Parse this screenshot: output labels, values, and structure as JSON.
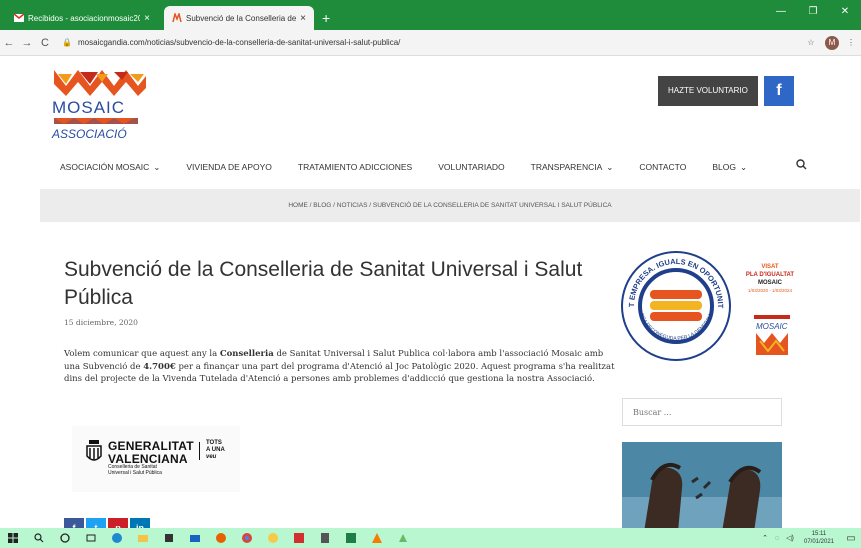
{
  "browser": {
    "tabs": [
      {
        "title": "Recibidos - asociacionmosaic20...",
        "active": false,
        "favicon": "gmail-icon"
      },
      {
        "title": "Subvenció de la Conselleria de S...",
        "active": true,
        "favicon": "mosaic-favicon"
      }
    ],
    "new_tab": "+",
    "window_controls": [
      "—",
      "❐",
      "✕"
    ],
    "address": "mosaicgandia.com/noticias/subvencio-de-la-conselleria-de-sanitat-universal-i-salut-publica/",
    "profile_initial": "M"
  },
  "site": {
    "logo_text_top": "MOSAIC",
    "logo_text_bottom": "ASSOCIACIÓ",
    "cta": {
      "volunteer": "HAZTE VOLUNTARIO",
      "facebook": "f"
    },
    "menu": [
      {
        "label": "ASOCIACIÓN MOSAIC",
        "caret": true
      },
      {
        "label": "VIVIENDA DE APOYO",
        "caret": false
      },
      {
        "label": "TRATAMIENTO ADICCIONES",
        "caret": false
      },
      {
        "label": "VOLUNTARIADO",
        "caret": false
      },
      {
        "label": "TRANSPARENCIA",
        "caret": true
      },
      {
        "label": "CONTACTO",
        "caret": false
      },
      {
        "label": "BLOG",
        "caret": true
      }
    ],
    "breadcrumb": {
      "home": "HOME",
      "blog": "BLOG",
      "category": "NOTICIAS",
      "current": "SUBVENCIÓ DE LA CONSELLERIA DE SANITAT UNIVERSAL I SALUT PÚBLICA"
    }
  },
  "post": {
    "title": "Subvenció de la Conselleria de Sanitat Universal i Salut Pública",
    "date": "15 diciembre, 2020",
    "body_a": "Volem comunicar que aquest any la ",
    "body_b": "Conselleria",
    "body_c": " de Sanitat Universal i Salut Publica col·labora amb l'associació Mosaic amb una Subvenció de ",
    "body_d": "4.700€",
    "body_e": " per a finançar una part del programa d'Atenció al Joc Patològic 2020. Aquest programa s'ha realitzat dins del projecte de la Vivenda Tutelada d'Atenció a persones amb problemes d'addicció que gestiona la nostra Associació.",
    "gv_name_1": "GENERALITAT",
    "gv_name_2": "VALENCIANA",
    "gv_sub_1": "Conselleria de Sanitat",
    "gv_sub_2": "Universal i Salut Pública",
    "gv_tots_1": "TOTS",
    "gv_tots_2": "A UNA",
    "gv_tots_3": "veu",
    "share": [
      "f",
      "t",
      "p",
      "in"
    ]
  },
  "sidebar": {
    "award_ring_top": "FENT EMPRESA. IGUALS EN OPORTUNITATS",
    "award_ring_bottom": "MARCA RECONEGUDA PER LA GENERALITAT",
    "visat_1": "VISAT",
    "visat_2": "PLA D'IGUALTAT",
    "visat_3": "MOSAIC",
    "visat_4": "1/03/2020 - 1/03/2024",
    "mini_logo": "MOSAIC",
    "search_placeholder": "Buscar ..."
  },
  "taskbar": {
    "time": "15:11",
    "date": "07/01/2021"
  },
  "colors": {
    "tabbar": "#1e8c3a",
    "facebook": "#2f67c6",
    "volunteer_bg": "#444444",
    "taskbar": "#b9f7d1",
    "mosaic_blue": "#2b4da0"
  }
}
